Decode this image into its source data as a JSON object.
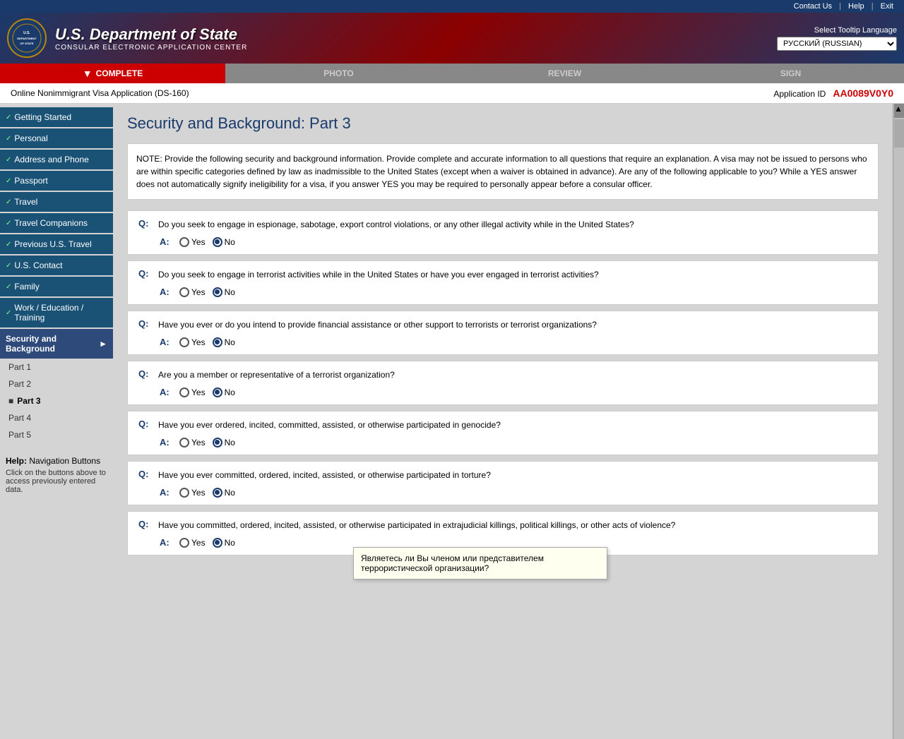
{
  "topbar": {
    "contact": "Contact Us",
    "help": "Help",
    "exit": "Exit"
  },
  "header": {
    "agency_line1": "U.S. Department of State",
    "agency_line2": "CONSULAR ELECTRONIC APPLICATION CENTER",
    "lang_label": "Select Tooltip Language",
    "lang_value": "РУССКИЙ (RUSSIAN)"
  },
  "nav_tabs": [
    {
      "label": "COMPLETE",
      "state": "active"
    },
    {
      "label": "PHOTO",
      "state": "inactive"
    },
    {
      "label": "REVIEW",
      "state": "inactive"
    },
    {
      "label": "SIGN",
      "state": "inactive"
    }
  ],
  "app_info": {
    "title": "Online Nonimmigrant Visa Application (DS-160)",
    "id_label": "Application ID",
    "id_value": "AA0089V0Y0"
  },
  "sidebar": {
    "items": [
      {
        "label": "Getting Started",
        "completed": true
      },
      {
        "label": "Personal",
        "completed": true
      },
      {
        "label": "Address and Phone",
        "completed": true
      },
      {
        "label": "Passport",
        "completed": true
      },
      {
        "label": "Travel",
        "completed": true
      },
      {
        "label": "Travel Companions",
        "completed": true
      },
      {
        "label": "Previous U.S. Travel",
        "completed": true
      },
      {
        "label": "U.S. Contact",
        "completed": true
      },
      {
        "label": "Family",
        "completed": true
      },
      {
        "label": "Work / Education / Training",
        "completed": true
      },
      {
        "label": "Security and Background",
        "active": true,
        "expanded": true
      }
    ],
    "sub_items": [
      {
        "label": "Part 1"
      },
      {
        "label": "Part 2"
      },
      {
        "label": "Part 3",
        "current": true
      },
      {
        "label": "Part 4"
      },
      {
        "label": "Part 5"
      }
    ]
  },
  "help": {
    "title": "Help:",
    "subtitle": "Navigation Buttons",
    "text": "Click on the buttons above to access previously entered data."
  },
  "page": {
    "title": "Security and Background: Part 3"
  },
  "note": {
    "text": "NOTE: Provide the following security and background information. Provide complete and accurate information to all questions that require an explanation. A visa may not be issued to persons who are within specific categories defined by law as inadmissible to the United States (except when a waiver is obtained in advance). Are any of the following applicable to you? While a YES answer does not automatically signify ineligibility for a visa, if you answer YES you may be required to personally appear before a consular officer."
  },
  "questions": [
    {
      "id": "q1",
      "q_label": "Q:",
      "a_label": "A:",
      "text": "Do you seek to engage in espionage, sabotage, export control violations, or any other illegal activity while in the United States?",
      "answer": "No"
    },
    {
      "id": "q2",
      "q_label": "Q:",
      "a_label": "A:",
      "text": "Do you seek to engage in terrorist activities while in the United States or have you ever engaged in terrorist activities?",
      "answer": "No"
    },
    {
      "id": "q3",
      "q_label": "Q:",
      "a_label": "A:",
      "text": "Have you ever or do you intend to provide financial assistance or other support to terrorists or terrorist organizations?",
      "answer": "No"
    },
    {
      "id": "q4",
      "q_label": "Q:",
      "a_label": "A:",
      "text": "Are you a member or representative of a terrorist organization?",
      "answer": "No"
    },
    {
      "id": "q5",
      "q_label": "Q:",
      "a_label": "A:",
      "text": "Have you ever ordered, incited, committed, assisted, or otherwise participated in genocide?",
      "answer": "No"
    },
    {
      "id": "q6",
      "q_label": "Q:",
      "a_label": "A:",
      "text": "Have you ever committed, ordered, incited, assisted, or otherwise participated in torture?",
      "answer": "No"
    },
    {
      "id": "q7",
      "q_label": "Q:",
      "a_label": "A:",
      "text": "Have you committed, ordered, incited, assisted, or otherwise participated in extrajudicial killings, political killings, or other acts of violence?",
      "answer": "No"
    }
  ],
  "tooltip": {
    "text": "Являетесь ли Вы членом или представителем террористической организации?"
  },
  "radio": {
    "yes_label": "Yes",
    "no_label": "No"
  }
}
